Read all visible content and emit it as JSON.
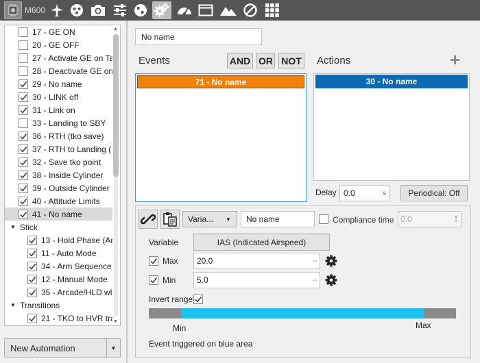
{
  "toolbar": {
    "device_label": "M600",
    "icons": [
      "chip-icon",
      "airplane-icon",
      "dots-circle-icon",
      "camera-icon",
      "sliders-icon",
      "globe-icon",
      "gears-icon",
      "gauge-icon",
      "window-icon",
      "mountain-icon",
      "prohibited-icon",
      "grid-icon"
    ],
    "active_icon": "gears-icon"
  },
  "tree": {
    "rows": [
      {
        "label": "17 - GE ON",
        "checked": false
      },
      {
        "label": "20 - GE OFF",
        "checked": false
      },
      {
        "label": "27 - Activate GE on Ta",
        "checked": false
      },
      {
        "label": "28 - Deactivate GE on",
        "checked": false
      },
      {
        "label": "29 - No name",
        "checked": true
      },
      {
        "label": "30 - LINK off",
        "checked": true
      },
      {
        "label": "31 - Link on",
        "checked": true
      },
      {
        "label": "33 - Landing to SBY",
        "checked": false
      },
      {
        "label": "36 - RTH (tko save)",
        "checked": true
      },
      {
        "label": "37 - RTH to Landing (",
        "checked": true
      },
      {
        "label": "32 - Save tko point",
        "checked": true
      },
      {
        "label": "38 - Inside Cylinder",
        "checked": true
      },
      {
        "label": "39 - Outside Cylinder",
        "checked": true
      },
      {
        "label": "40 - Attitude Limits",
        "checked": true
      },
      {
        "label": "41 - No name",
        "checked": true,
        "selected": true
      }
    ],
    "stick_group": "Stick",
    "stick_rows": [
      {
        "label": "13 - Hold Phase (Ar",
        "checked": true
      },
      {
        "label": "11 - Auto Mode",
        "checked": true
      },
      {
        "label": "34 - Arm Sequence",
        "checked": true
      },
      {
        "label": "12 - Manual Mode",
        "checked": true
      },
      {
        "label": "35 - Arcade/HLD wl",
        "checked": true
      }
    ],
    "transitions_group": "Transitions",
    "transition_rows": [
      {
        "label": "21 - TKO to HVR tra",
        "checked": true
      }
    ]
  },
  "new_automation_label": "New Automation",
  "automation_name": "No name",
  "events": {
    "title": "Events",
    "and_label": "AND",
    "or_label": "OR",
    "not_label": "NOT",
    "items": [
      "71 - No name"
    ]
  },
  "actions": {
    "title": "Actions",
    "items": [
      "30 - No name"
    ]
  },
  "delay": {
    "label": "Delay",
    "value": "0.0",
    "unit": "s"
  },
  "periodical_label": "Periodical: Off",
  "event_detail": {
    "type_label": "Varia...",
    "name": "No name",
    "compliance_label": "Compliance time",
    "compliance_value": "0.0",
    "variable_label": "Variable",
    "variable_value": "IAS (Indicated Airspeed)",
    "max_label": "Max",
    "max_value": "20.0",
    "min_label": "Min",
    "min_value": "5.0",
    "dash": "--",
    "invert_label": "Invert range",
    "range_min_label": "Min",
    "range_max_label": "Max",
    "trigger_note": "Event triggered on blue area",
    "blue_range": [
      0.105,
      0.895
    ]
  },
  "colors": {
    "toolbar_bg": "#555555",
    "event_item": "#f0820b",
    "action_item": "#0c6ab3",
    "range_blue": "#1ec0f0",
    "range_gray": "#8a8a8a"
  }
}
